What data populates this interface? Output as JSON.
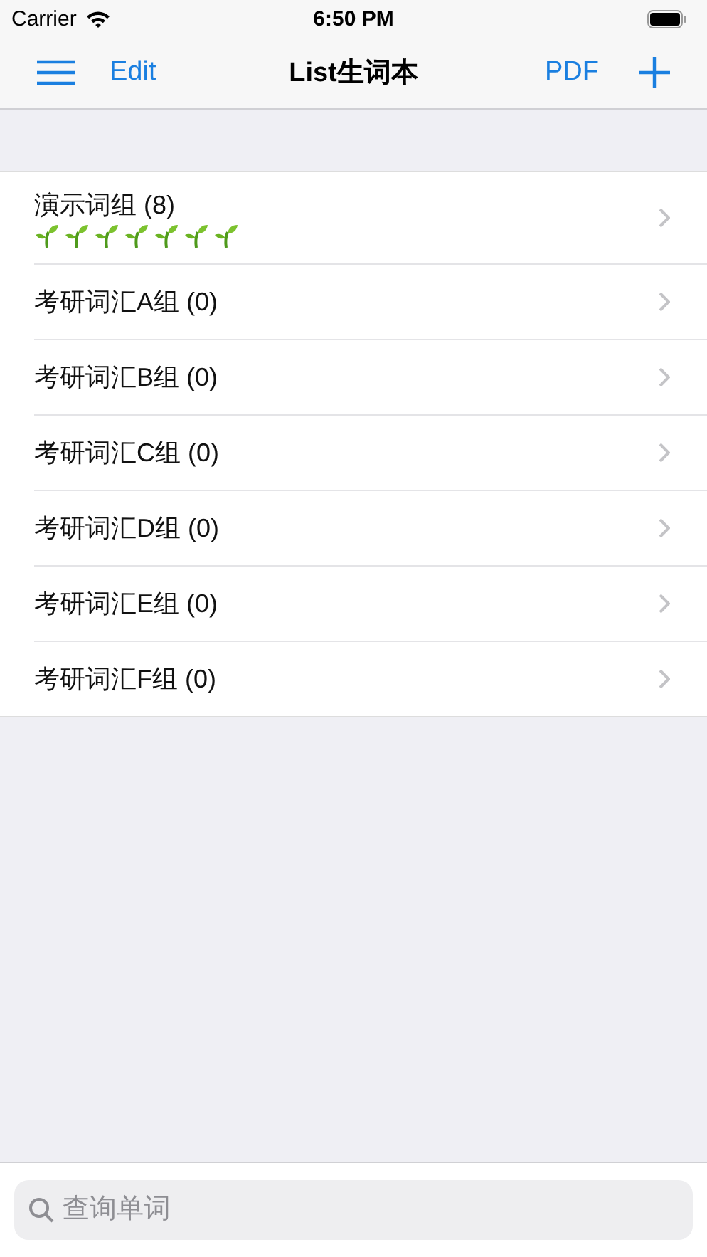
{
  "status_bar": {
    "carrier": "Carrier",
    "time": "6:50 PM"
  },
  "nav": {
    "edit": "Edit",
    "title": "List生词本",
    "pdf": "PDF"
  },
  "groups": [
    {
      "name": "演示词组 (8)",
      "badges": [
        {
          "kind": "sprout"
        },
        {
          "kind": "sprout"
        },
        {
          "kind": "sprout"
        },
        {
          "kind": "sprout"
        },
        {
          "kind": "sprout"
        },
        {
          "kind": "sprout"
        },
        {
          "kind": "sprout"
        }
      ]
    },
    {
      "name": "考研词汇A组 (0)"
    },
    {
      "name": "考研词汇B组 (0)"
    },
    {
      "name": "考研词汇C组 (0)"
    },
    {
      "name": "考研词汇D组 (0)"
    },
    {
      "name": "考研词汇E组 (0)"
    },
    {
      "name": "考研词汇F组 (0)"
    }
  ],
  "search": {
    "placeholder": "查询单词"
  }
}
